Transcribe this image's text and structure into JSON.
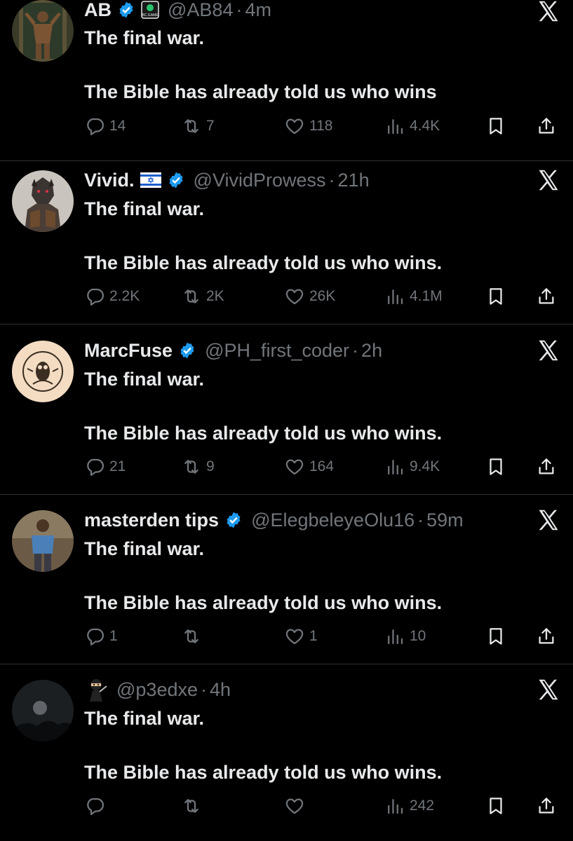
{
  "tweets": [
    {
      "name": "AB",
      "handle": "@AB84",
      "time": "4m",
      "affiliate_label": "BC.GAME",
      "line1": "The final war.",
      "line2": "The Bible has already told us who wins",
      "replies": "14",
      "reposts": "7",
      "likes": "118",
      "views": "4.4K"
    },
    {
      "name": "Vivid.",
      "handle": "@VividProwess",
      "time": "21h",
      "line1": "The final war.",
      "line2": "The Bible has already told us who wins.",
      "replies": "2.2K",
      "reposts": "2K",
      "likes": "26K",
      "views": "4.1M"
    },
    {
      "name": "MarcFuse",
      "handle": "@PH_first_coder",
      "time": "2h",
      "line1": "The final war.",
      "line2": "The Bible has already told us who wins.",
      "replies": "21",
      "reposts": "9",
      "likes": "164",
      "views": "9.4K"
    },
    {
      "name": "masterden tips",
      "handle": "@ElegbeleyeOlu16",
      "time": "59m",
      "line1": "The final war.",
      "line2": "The Bible has already told us who wins.",
      "replies": "1",
      "reposts": "",
      "likes": "1",
      "views": "10"
    },
    {
      "name": "",
      "handle": "@p3edxe",
      "time": "4h",
      "line1": "The final war.",
      "line2": "The Bible has already told us who wins.",
      "replies": "",
      "reposts": "",
      "likes": "",
      "views": "242"
    }
  ],
  "separator": "·",
  "colors": {
    "background": "#000000",
    "text": "#e7e9ea",
    "muted": "#71767b",
    "verified": "#1d9bf0",
    "divider": "#2f3336"
  },
  "icons": [
    "reply-icon",
    "repost-icon",
    "like-icon",
    "views-icon",
    "bookmark-icon",
    "share-icon",
    "x-logo-icon",
    "verified-badge-icon",
    "israel-flag-icon",
    "ninja-emoji-icon"
  ]
}
